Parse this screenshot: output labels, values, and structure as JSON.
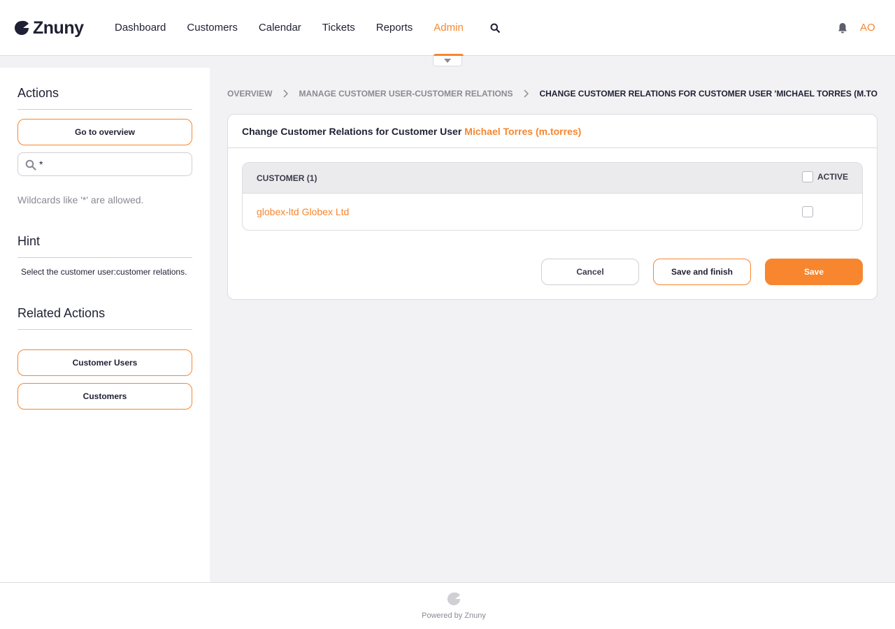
{
  "app": {
    "name": "Znuny"
  },
  "nav": {
    "items": [
      {
        "label": "Dashboard",
        "active": false
      },
      {
        "label": "Customers",
        "active": false
      },
      {
        "label": "Calendar",
        "active": false
      },
      {
        "label": "Tickets",
        "active": false
      },
      {
        "label": "Reports",
        "active": false
      },
      {
        "label": "Admin",
        "active": true
      }
    ],
    "search_icon": "search-icon",
    "notification_icon": "bell-icon",
    "user_initials": "AO"
  },
  "sidebar": {
    "actions_heading": "Actions",
    "go_to_overview": "Go to overview",
    "search_value": "*",
    "wildcard_note": "Wildcards like '*' are allowed.",
    "hint_heading": "Hint",
    "hint_text": "Select the customer user:customer relations.",
    "related_heading": "Related Actions",
    "related_items": [
      "Customer Users",
      "Customers"
    ]
  },
  "breadcrumb": [
    {
      "label": "OVERVIEW"
    },
    {
      "label": "MANAGE CUSTOMER USER-CUSTOMER RELATIONS"
    },
    {
      "label": "CHANGE CUSTOMER RELATIONS FOR CUSTOMER USER 'MICHAEL TORRES (M.TO"
    }
  ],
  "panel": {
    "title_prefix": "Change Customer Relations for Customer User",
    "title_name": "Michael Torres (m.torres)",
    "table": {
      "col_customer": "CUSTOMER (1)",
      "col_active": "ACTIVE",
      "rows": [
        {
          "customer": "globex-ltd Globex Ltd",
          "active": false
        }
      ]
    },
    "buttons": {
      "cancel": "Cancel",
      "save_finish": "Save and finish",
      "save": "Save"
    }
  },
  "footer": {
    "text": "Powered by Znuny"
  },
  "colors": {
    "accent": "#f7862f",
    "text": "#1f2033",
    "muted": "#8a8a93",
    "background": "#f2f2f4"
  }
}
